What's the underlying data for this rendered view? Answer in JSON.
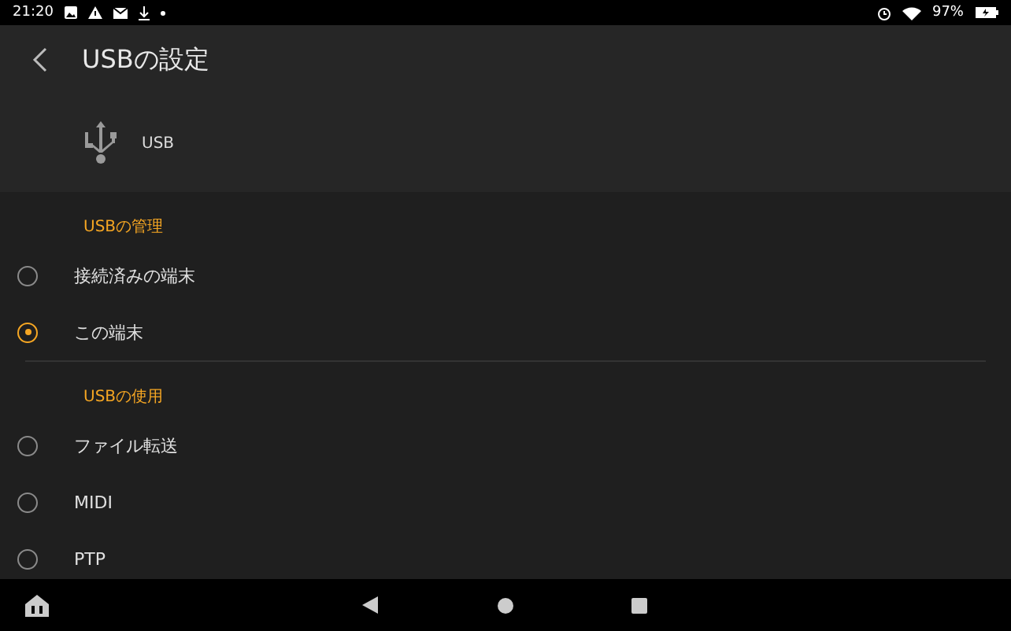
{
  "status_bar": {
    "time": "21:20",
    "battery": "97%"
  },
  "app_bar": {
    "title": "USBの設定"
  },
  "device_header": {
    "label": "USB"
  },
  "sections": [
    {
      "title": "USBの管理",
      "options": [
        {
          "label": "接続済みの端末",
          "selected": false
        },
        {
          "label": "この端末",
          "selected": true
        }
      ]
    },
    {
      "title": "USBの使用",
      "options": [
        {
          "label": "ファイル転送",
          "selected": false
        },
        {
          "label": "MIDI",
          "selected": false
        },
        {
          "label": "PTP",
          "selected": false
        }
      ]
    }
  ]
}
